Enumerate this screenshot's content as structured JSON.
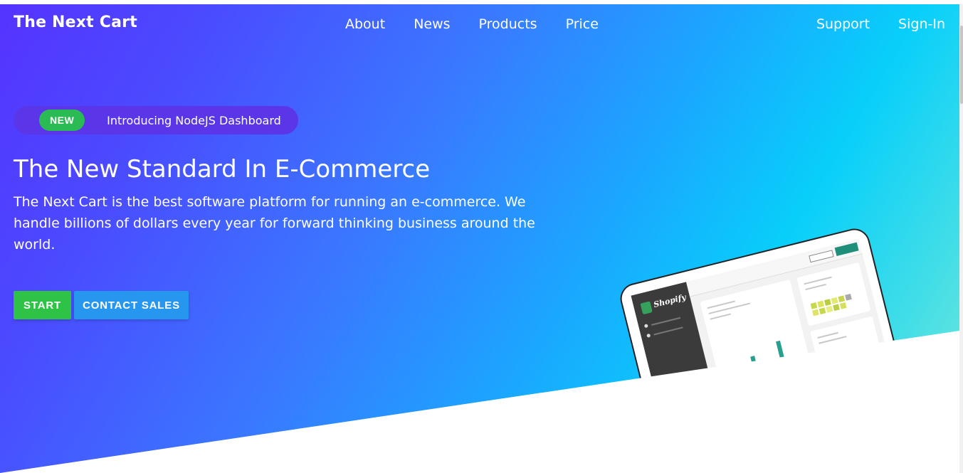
{
  "header": {
    "brand": "The Next Cart",
    "nav_center": [
      "About",
      "News",
      "Products",
      "Price"
    ],
    "nav_right": [
      "Support",
      "Sign-In"
    ]
  },
  "announcement": {
    "badge": "NEW",
    "text": "Introducing NodeJS Dashboard"
  },
  "hero": {
    "title": "The New Standard In E-Commerce",
    "description": "The Next Cart is the best software platform for running an e-commerce. We handle billions of dollars every year for forward thinking business around the world."
  },
  "actions": {
    "start_label": "START",
    "contact_label": "CONTACT SALES"
  },
  "illustration": {
    "app_label": "Shopify"
  },
  "colors": {
    "gradient_start": "#5533ff",
    "gradient_end": "#7ce9d6",
    "start_button": "#2ec346",
    "contact_button": "#2796ee",
    "badge": "#2bbb55"
  }
}
